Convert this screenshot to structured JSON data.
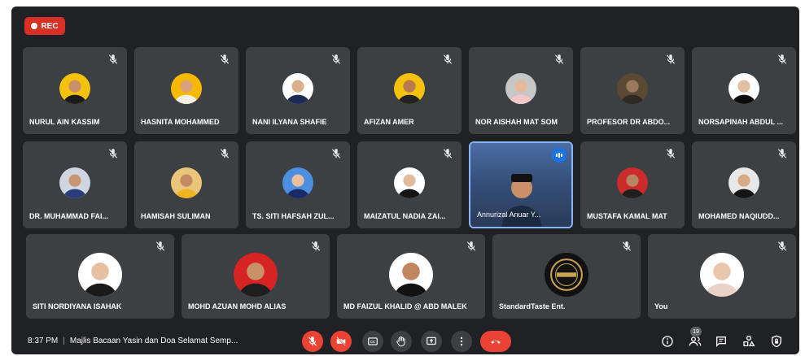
{
  "recording": {
    "label": "REC"
  },
  "participants_row1": [
    {
      "name": "NURUL AIN KASSIM",
      "skin": "#c8916a",
      "top": "#1b1b1b",
      "bg": "#f4c20d"
    },
    {
      "name": "HASNITA MOHAMMED",
      "skin": "#d9a27a",
      "top": "#f5f0e6",
      "bg": "#f6b900"
    },
    {
      "name": "NANI ILYANA SHAFIE",
      "skin": "#dcb08c",
      "top": "#1c2a56",
      "bg": "#ffffff"
    },
    {
      "name": "AFIZAN AMER",
      "skin": "#b97a52",
      "top": "#222222",
      "bg": "#f4c20d"
    },
    {
      "name": "NOR AISHAH MAT SOM",
      "skin": "#e6b99a",
      "top": "#f3c6c9",
      "bg": "#c7c7c7"
    },
    {
      "name": "PROFESOR DR ABDO...",
      "skin": "#9b7a5c",
      "top": "#2e2a24",
      "bg": "#5a4a34"
    },
    {
      "name": "NORSAPINAH ABDUL ...",
      "skin": "#e2bfa3",
      "top": "#0d0d0d",
      "bg": "#ffffff"
    }
  ],
  "participants_row2": [
    {
      "name": "DR. MUHAMMAD FAI...",
      "skin": "#c99673",
      "top": "#2a3d7a",
      "bg": "#d0d6e0"
    },
    {
      "name": "HAMISAH SULIMAN",
      "skin": "#c48a63",
      "top": "#f2b320",
      "bg": "#e9c67a"
    },
    {
      "name": "TS. SITI HAFSAH ZUL...",
      "skin": "#e6c0a0",
      "top": "#1b2a66",
      "bg": "#4c8fe0"
    },
    {
      "name": "MAIZATUL NADIA ZAI...",
      "skin": "#e0bb9c",
      "top": "#161616",
      "bg": "#ffffff"
    },
    {
      "name": "Annurizal Anuar Y...",
      "active": true
    },
    {
      "name": "MUSTAFA KAMAL MAT",
      "skin": "#b98560",
      "top": "#1f1f1f",
      "bg": "#cc2b2b"
    },
    {
      "name": "MOHAMED NAQIUDD...",
      "skin": "#d6ab86",
      "top": "#141414",
      "bg": "#e8e8e8"
    }
  ],
  "participants_row3": [
    {
      "name": "SITI NORDIYANA ISAHAK",
      "skin": "#e6c0a0",
      "top": "#1a1a1a",
      "bg": "#ffffff"
    },
    {
      "name": "MOHD AZUAN MOHD ALIAS",
      "skin": "#c8916a",
      "top": "#1e1e1e",
      "bg": "#d62424"
    },
    {
      "name": "MD FAIZUL KHALID @ ABD MALEK",
      "skin": "#c08660",
      "top": "#121212",
      "bg": "#ffffff"
    },
    {
      "name": "StandardTaste Ent.",
      "logo": true
    },
    {
      "name": "You",
      "skin": "#eac7ab",
      "top": "#e9d3c9",
      "bg": "#ffffff"
    }
  ],
  "bottom": {
    "time": "8:37 PM",
    "separator": "|",
    "meeting_title": "Majlis Bacaan Yasin dan Doa Selamat Semp...",
    "participant_count": "19"
  },
  "colors": {
    "background": "#202124",
    "tile": "#3c4043",
    "red": "#ea4335",
    "active_border": "#8ab4f8"
  }
}
